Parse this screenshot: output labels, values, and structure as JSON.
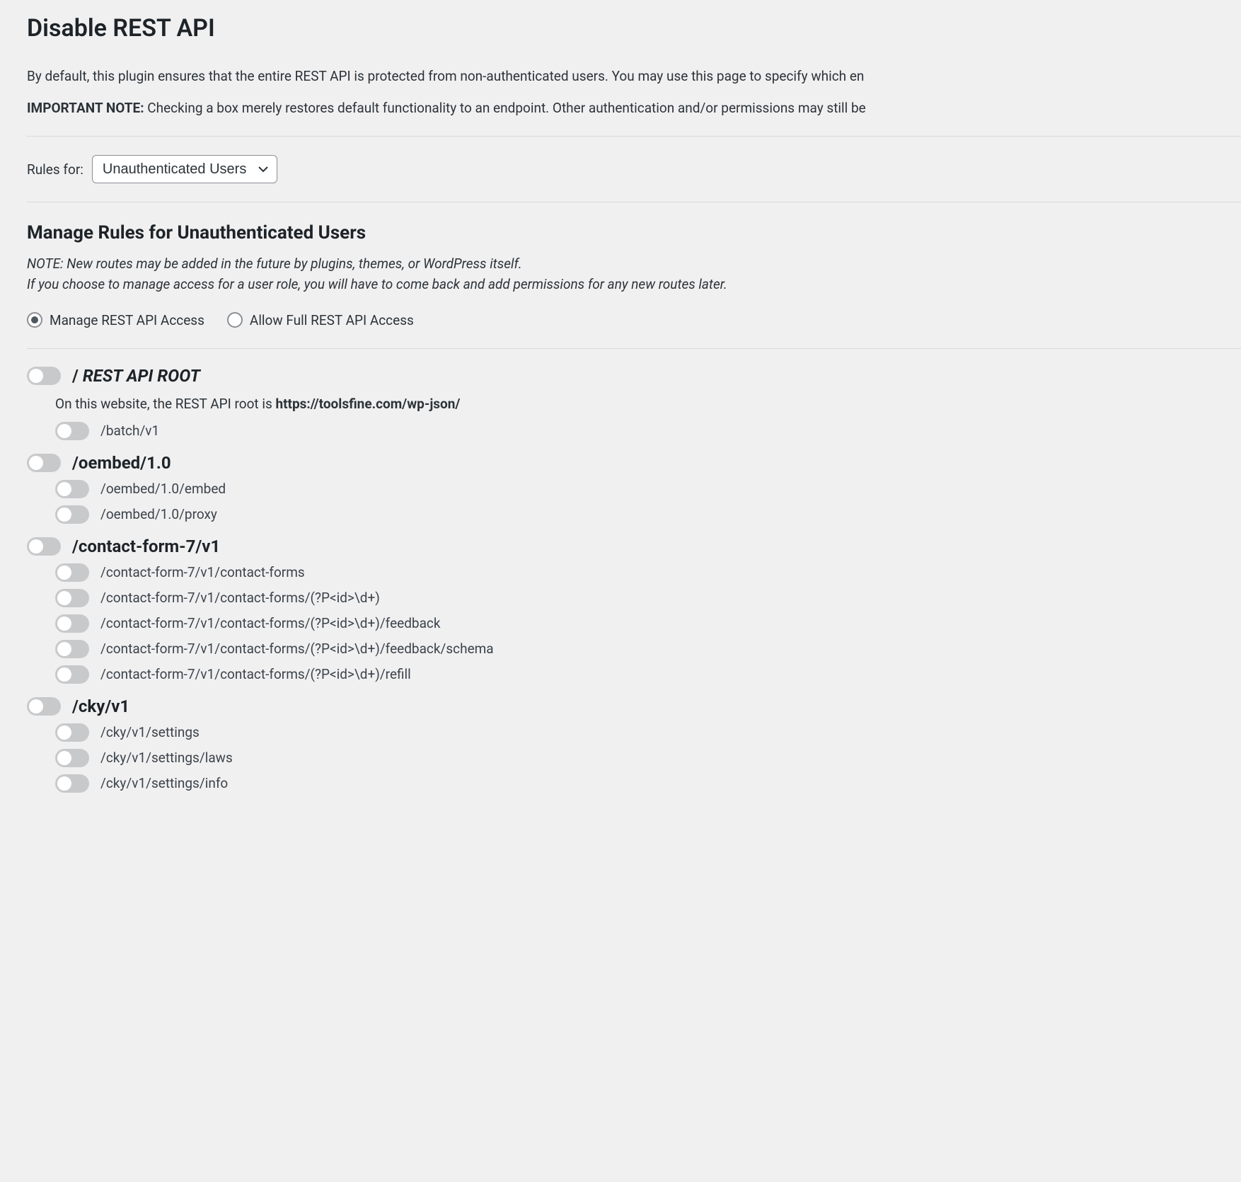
{
  "page_title": "Disable REST API",
  "intro": "By default, this plugin ensures that the entire REST API is protected from non-authenticated users. You may use this page to specify which en",
  "important_note_label": "IMPORTANT NOTE:",
  "important_note_text": " Checking a box merely restores default functionality to an endpoint. Other authentication and/or permissions may still be ",
  "rules_for_label": "Rules for:",
  "rules_for_select": {
    "selected": "Unauthenticated Users"
  },
  "section_title": "Manage Rules for Unauthenticated Users",
  "note_line1": "NOTE: New routes may be added in the future by plugins, themes, or WordPress itself.",
  "note_line2": "If you choose to manage access for a user role, you will have to come back and add permissions for any new routes later.",
  "radio_options": {
    "manage": "Manage REST API Access",
    "allow_full": "Allow Full REST API Access",
    "selected": "manage"
  },
  "root_group": {
    "prefix": "/",
    "suffix": " REST API ROOT",
    "info_prefix": "On this website, the REST API root is ",
    "info_url": "https://toolsfine.com/wp-json/",
    "children": [
      "/batch/v1"
    ]
  },
  "groups": [
    {
      "label": "/oembed/1.0",
      "children": [
        "/oembed/1.0/embed",
        "/oembed/1.0/proxy"
      ]
    },
    {
      "label": "/contact-form-7/v1",
      "children": [
        "/contact-form-7/v1/contact-forms",
        "/contact-form-7/v1/contact-forms/(?P<id>\\d+)",
        "/contact-form-7/v1/contact-forms/(?P<id>\\d+)/feedback",
        "/contact-form-7/v1/contact-forms/(?P<id>\\d+)/feedback/schema",
        "/contact-form-7/v1/contact-forms/(?P<id>\\d+)/refill"
      ]
    },
    {
      "label": "/cky/v1",
      "children": [
        "/cky/v1/settings",
        "/cky/v1/settings/laws",
        "/cky/v1/settings/info"
      ]
    }
  ]
}
